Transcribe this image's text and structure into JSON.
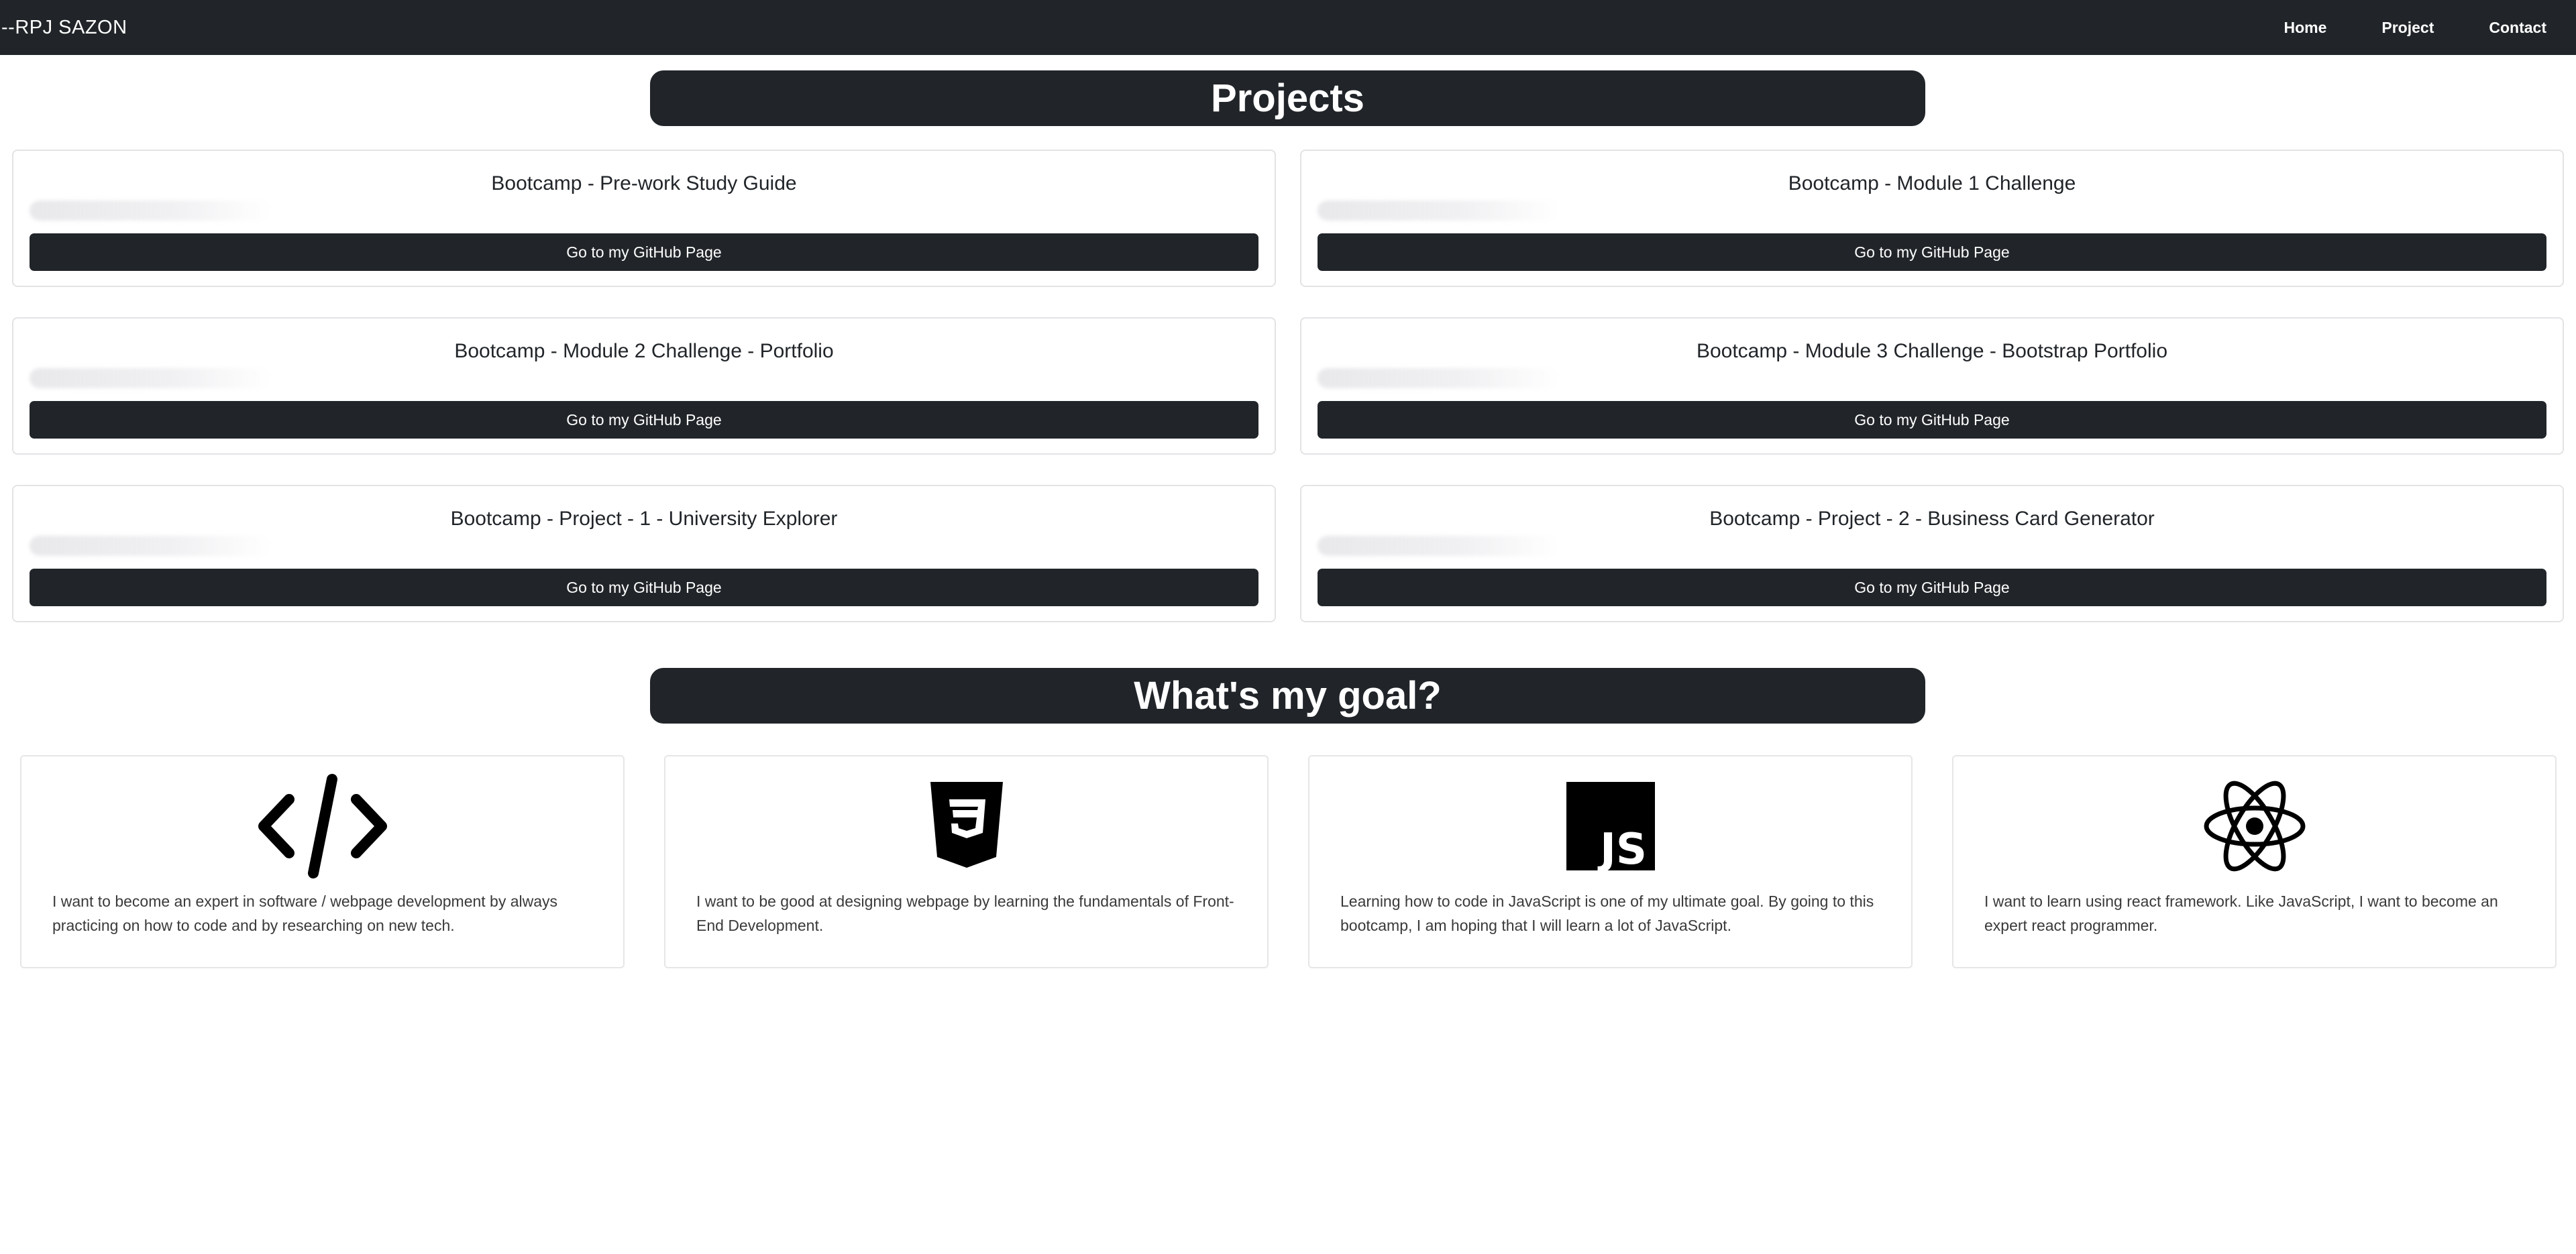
{
  "navbar": {
    "brand": "--RPJ SAZON",
    "links": [
      "Home",
      "Project",
      "Contact"
    ]
  },
  "projects": {
    "title": "Projects",
    "button_label": "Go to my GitHub Page",
    "items": [
      {
        "title": "Bootcamp - Pre-work Study Guide"
      },
      {
        "title": "Bootcamp - Module 1 Challenge"
      },
      {
        "title": "Bootcamp - Module 2 Challenge - Portfolio"
      },
      {
        "title": "Bootcamp - Module 3 Challenge - Bootstrap Portfolio"
      },
      {
        "title": "Bootcamp - Project - 1 - University Explorer"
      },
      {
        "title": "Bootcamp - Project - 2 - Business Card Generator"
      }
    ]
  },
  "goals": {
    "title": "What's my goal?",
    "items": [
      {
        "icon": "code-icon",
        "text": "I want to become an expert in software / webpage development by always practicing on how to code and by researching on new tech."
      },
      {
        "icon": "css3-icon",
        "text": "I want to be good at designing webpage by learning the fundamentals of Front-End Development."
      },
      {
        "icon": "javascript-icon",
        "text": "Learning how to code in JavaScript is one of my ultimate goal. By going to this bootcamp, I am hoping that I will learn a lot of JavaScript."
      },
      {
        "icon": "react-icon",
        "text": "I want to learn using react framework. Like JavaScript, I want to become an expert react programmer."
      }
    ]
  },
  "colors": {
    "dark": "#212529",
    "card_border": "#e3e3e6",
    "background": "#ffffff"
  }
}
